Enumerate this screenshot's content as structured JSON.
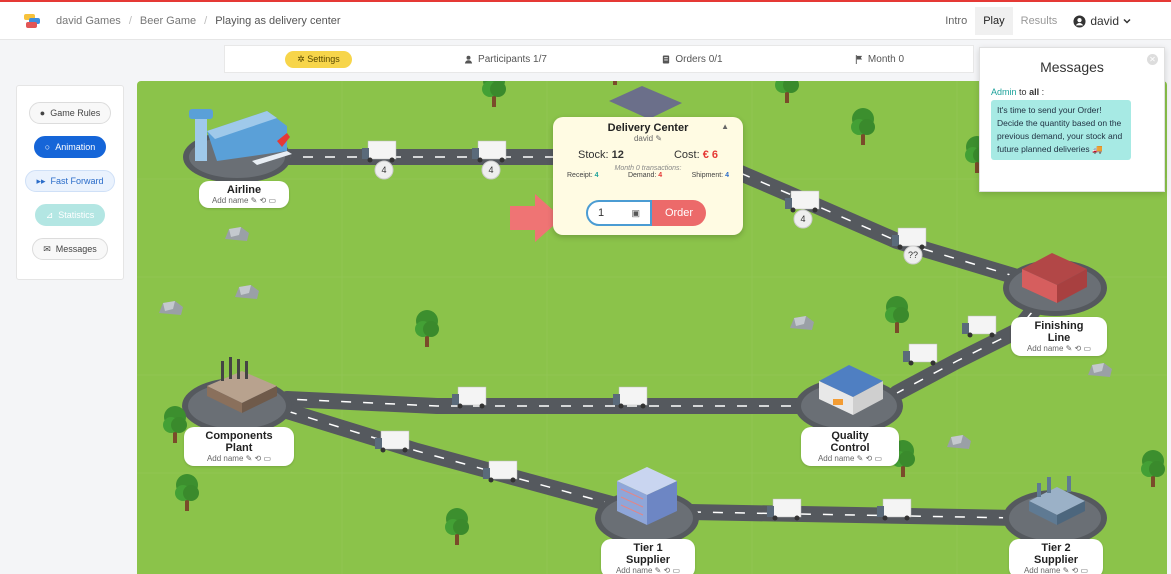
{
  "breadcrumb": {
    "games": "david Games",
    "game": "Beer Game",
    "current": "Playing as delivery center"
  },
  "topnav": {
    "intro": "Intro",
    "play": "Play",
    "results": "Results",
    "user": "david"
  },
  "statusbar": {
    "settings": "Settings",
    "participants": "Participants 1/7",
    "orders": "Orders 0/1",
    "month": "Month 0"
  },
  "sidebar": {
    "game_rules": "Game Rules",
    "animation": "Animation",
    "fast_forward": "Fast Forward",
    "statistics": "Statistics",
    "messages": "Messages"
  },
  "nodes": {
    "airline": {
      "name": "Airline",
      "sub": "Add name"
    },
    "components": {
      "name": "Components Plant",
      "sub": "Add name"
    },
    "tier1": {
      "name": "Tier 1 Supplier",
      "sub": "Add name"
    },
    "tier2": {
      "name": "Tier 2 Supplier",
      "sub": "Add name"
    },
    "quality": {
      "name": "Quality Control",
      "sub": "Add name"
    },
    "finishing": {
      "name": "Finishing Line",
      "sub": "Add name"
    }
  },
  "truck_counts": {
    "a": "4",
    "b": "4",
    "c": "4",
    "d": "??"
  },
  "delivery_center": {
    "title": "Delivery Center",
    "owner": "david",
    "stock_label": "Stock:",
    "stock_value": "12",
    "cost_label": "Cost:",
    "cost_value": "€ 6",
    "transactions": "Month 0 transactions:",
    "receipt_label": "Receipt:",
    "receipt_value": "4",
    "demand_label": "Demand:",
    "demand_value": "4",
    "shipment_label": "Shipment:",
    "shipment_value": "4",
    "order_input": "1",
    "order_button": "Order"
  },
  "messages": {
    "title": "Messages",
    "from": "Admin",
    "to_text": "to",
    "to": "all",
    "body": "It's time to send your Order! Decide the quantity based on the previous demand, your stock and future planned deliveries 🚚"
  },
  "colors": {
    "grass": "#8bc34a",
    "road": "#55595e",
    "accent_red": "#e53935",
    "order_button": "#ec6a6a",
    "settings_pill": "#f7d54a"
  }
}
